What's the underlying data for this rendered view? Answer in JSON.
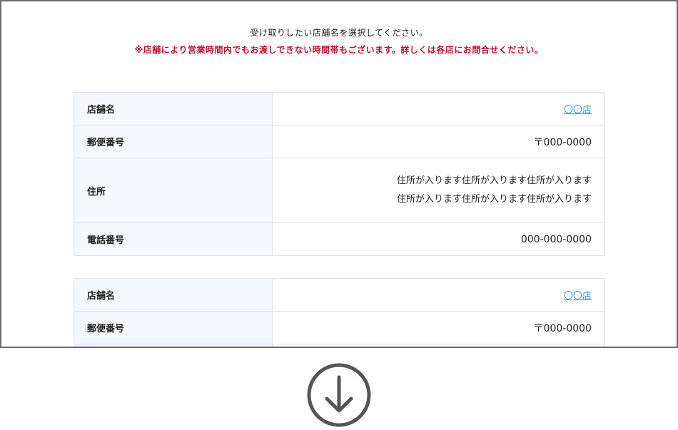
{
  "intro": {
    "main": "受け取りしたい店舗名を選択してください。",
    "note": "※店舗により営業時間内でもお渡しできない時間帯もございます。詳しくは各店にお問合せください。"
  },
  "labels": {
    "store_name": "店舗名",
    "postal_code": "郵便番号",
    "address": "住所",
    "phone": "電話番号"
  },
  "stores": [
    {
      "name": "〇〇店",
      "postal": "〒000-0000",
      "address_line1": "住所が入ります住所が入ります住所が入ります",
      "address_line2": "住所が入ります住所が入ります住所が入ります",
      "phone": "000-000-0000"
    },
    {
      "name": "〇〇店",
      "postal": "〒000-0000"
    }
  ],
  "icons": {
    "down_arrow": "arrow-down-circle-icon"
  },
  "colors": {
    "note_red": "#c4122f",
    "link_blue": "#2fa3c6",
    "label_bg": "#f4f7fb",
    "border": "#dde3ea",
    "arrow_gray": "#555555"
  }
}
